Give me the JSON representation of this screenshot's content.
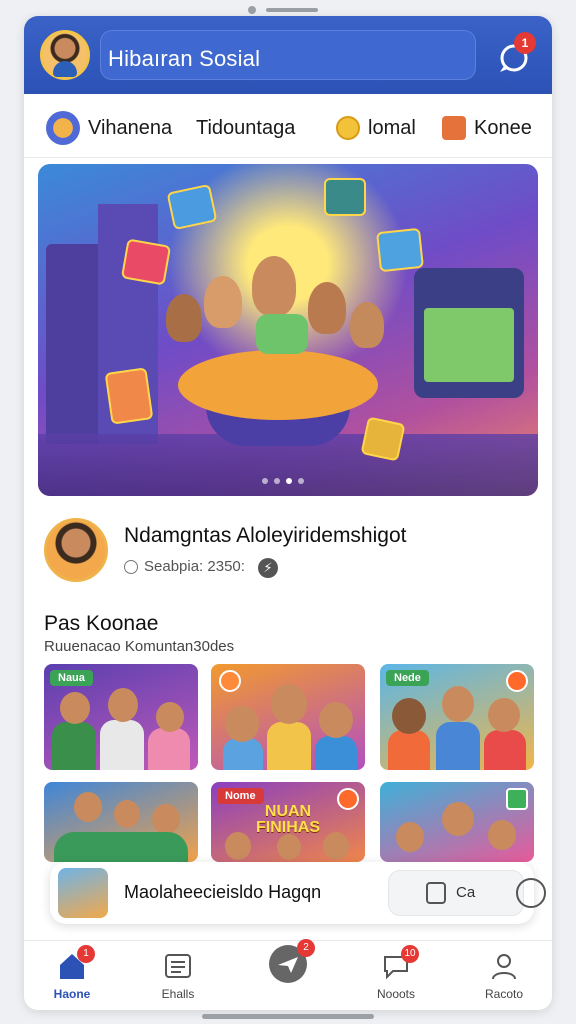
{
  "app": {
    "title": "Hibaıran Sosial",
    "notification_count": "1"
  },
  "categories": [
    {
      "label": "Vihanena",
      "icon": "game-icon"
    },
    {
      "label": "Tidountaga",
      "icon": ""
    },
    {
      "label": "lomal",
      "icon": "coin-icon"
    },
    {
      "label": "Konee",
      "icon": "gift-icon"
    }
  ],
  "hero": {
    "slides": 4,
    "active_slide": 3
  },
  "profile": {
    "name": "Ndamgntas Alolеyiridemshigot",
    "meta": "Seabpia: 2350:"
  },
  "section": {
    "title": "Pas Koonae",
    "subtitle": "Ruuenacao Komuntan30des"
  },
  "tiles": [
    {
      "tag": "Naua",
      "theme": "game-night"
    },
    {
      "tag": "",
      "theme": "family"
    },
    {
      "tag": "Nede",
      "theme": "friends"
    },
    {
      "tag": "",
      "theme": "board-game"
    },
    {
      "tag": "Nome",
      "title": "NUAN FINIHAS",
      "theme": "festival"
    },
    {
      "tag": "",
      "theme": "group"
    }
  ],
  "floating_card": {
    "text": "Maolaheecieisldo Hagqn",
    "action_label": "Ca"
  },
  "nav": [
    {
      "label": "Haone",
      "badge": "1",
      "active": true
    },
    {
      "label": "Ehalls",
      "badge": "",
      "active": false
    },
    {
      "label": "",
      "badge": "2",
      "active": false
    },
    {
      "label": "Nooots",
      "badge": "10",
      "active": false
    },
    {
      "label": "Racoto",
      "badge": "",
      "active": false
    }
  ],
  "colors": {
    "header": "#2c52b6",
    "accent": "#e53935"
  }
}
